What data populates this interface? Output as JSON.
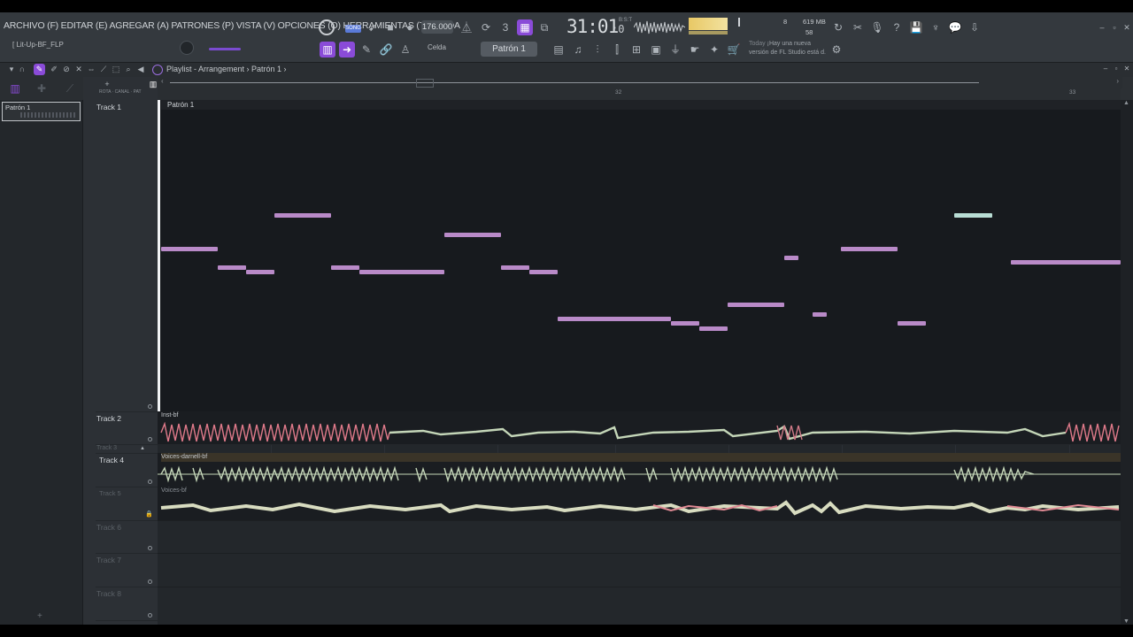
{
  "menu": {
    "text": "ARCHIVO (F) EDITAR (E) AGREGAR (A) PATRONES (P) VISTA (V) OPCIONES (O) HERRAMIENTAS (T) AYUDA"
  },
  "project": {
    "name": "[ Lit-Up-BF_FLP"
  },
  "transport": {
    "mode_label": "SONG",
    "tempo": "176.000",
    "time": "31:01",
    "time_ticks": ":0",
    "time_sub": "B:S:T"
  },
  "cpu": {
    "num": "8",
    "memory": "619 MB",
    "polyphony": "58"
  },
  "toolbar2": {
    "snap_label": "Celda",
    "pattern_label": "Patrón 1"
  },
  "news": {
    "today": "Today",
    "line1": "¡Hay una nueva",
    "line2": "versión de FL Studio está d."
  },
  "playlist": {
    "title": "Playlist - Arrangement › Patrón 1 ›"
  },
  "picker": {
    "item": "Patrón 1"
  },
  "ruler": {
    "bar32": "32",
    "bar33": "33"
  },
  "tracks": [
    {
      "label": "Track 1",
      "clip": "Patrón 1"
    },
    {
      "label": "Track 2",
      "clip": "Inst-bf"
    },
    {
      "label": "Track 3"
    },
    {
      "label": "Track 4",
      "clip": "Voices-darnell-bf"
    },
    {
      "label": "Track 5",
      "clip": "Voices-bf"
    },
    {
      "label": "Track 6"
    },
    {
      "label": "Track 7"
    },
    {
      "label": "Track 8"
    }
  ],
  "colors": {
    "note": "#b98ac8",
    "note_mint": "#b8ddd4",
    "wave_inst": "#e07a8a",
    "wave_voice": "#c4d6b8",
    "accent": "#8a4bd8"
  }
}
